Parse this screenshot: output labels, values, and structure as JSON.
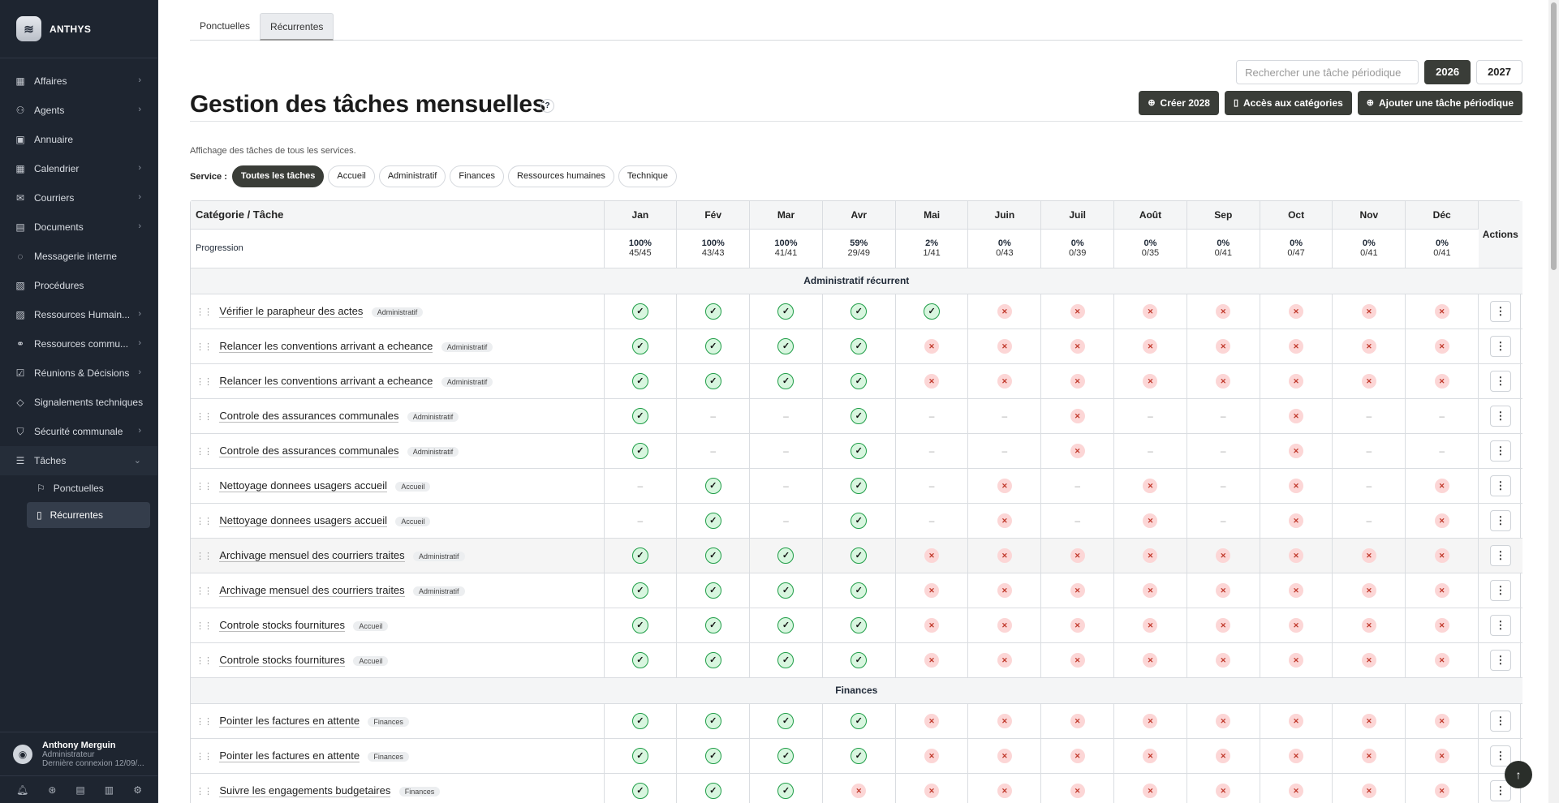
{
  "brand": {
    "name": "ANTHYS"
  },
  "sidebar": {
    "items": [
      {
        "label": "Affaires",
        "icon": "calculator-icon",
        "chevron": true
      },
      {
        "label": "Agents",
        "icon": "users-icon",
        "chevron": true
      },
      {
        "label": "Annuaire",
        "icon": "contact-card-icon",
        "chevron": false
      },
      {
        "label": "Calendrier",
        "icon": "calendar-icon",
        "chevron": true
      },
      {
        "label": "Courriers",
        "icon": "mailbox-icon",
        "chevron": true
      },
      {
        "label": "Documents",
        "icon": "document-icon",
        "chevron": true
      },
      {
        "label": "Messagerie interne",
        "icon": "chat-icon",
        "chevron": false
      },
      {
        "label": "Procédures",
        "icon": "procedure-icon",
        "chevron": false
      },
      {
        "label": "Ressources Humain...",
        "icon": "badge-icon",
        "chevron": true
      },
      {
        "label": "Ressources commu...",
        "icon": "shared-resources-icon",
        "chevron": true
      },
      {
        "label": "Réunions & Décisions",
        "icon": "calendar-check-icon",
        "chevron": true
      },
      {
        "label": "Signalements techniques",
        "icon": "warning-diamond-icon",
        "chevron": false
      },
      {
        "label": "Sécurité communale",
        "icon": "shield-icon",
        "chevron": true
      },
      {
        "label": "Tâches",
        "icon": "list-icon",
        "chevron": true
      }
    ],
    "sub_items": [
      {
        "label": "Ponctuelles",
        "icon": "flag-icon"
      },
      {
        "label": "Récurrentes",
        "icon": "clipboard-icon"
      }
    ]
  },
  "user": {
    "name": "Anthony Merguin",
    "role": "Administrateur",
    "last_login": "Dernière connexion 12/09/..."
  },
  "tabs": [
    {
      "label": "Ponctuelles"
    },
    {
      "label": "Récurrentes"
    }
  ],
  "search": {
    "placeholder": "Rechercher une tâche périodique"
  },
  "years": [
    "2026",
    "2027"
  ],
  "page": {
    "title": "Gestion des tâches mensuelles",
    "help": "?",
    "description": "Affichage des tâches de tous les services.",
    "service_label": "Service :"
  },
  "buttons": {
    "create": "Créer 2028",
    "categories": "Accès aux catégories",
    "add_task": "Ajouter une tâche périodique"
  },
  "filters": [
    "Toutes les tâches",
    "Accueil",
    "Administratif",
    "Finances",
    "Ressources humaines",
    "Technique"
  ],
  "table": {
    "col_category": "Catégorie / Tâche",
    "col_actions": "Actions",
    "months": [
      "Jan",
      "Fév",
      "Mar",
      "Avr",
      "Mai",
      "Juin",
      "Juil",
      "Août",
      "Sep",
      "Oct",
      "Nov",
      "Déc"
    ],
    "progress_label": "Progression",
    "progress": [
      {
        "pct": "100%",
        "frac": "45/45"
      },
      {
        "pct": "100%",
        "frac": "43/43"
      },
      {
        "pct": "100%",
        "frac": "41/41"
      },
      {
        "pct": "59%",
        "frac": "29/49"
      },
      {
        "pct": "2%",
        "frac": "1/41"
      },
      {
        "pct": "0%",
        "frac": "0/43"
      },
      {
        "pct": "0%",
        "frac": "0/39"
      },
      {
        "pct": "0%",
        "frac": "0/35"
      },
      {
        "pct": "0%",
        "frac": "0/41"
      },
      {
        "pct": "0%",
        "frac": "0/47"
      },
      {
        "pct": "0%",
        "frac": "0/41"
      },
      {
        "pct": "0%",
        "frac": "0/41"
      }
    ],
    "sections": [
      {
        "title": "Administratif récurrent",
        "rows": [
          {
            "name": "Vérifier le parapheur des actes",
            "badge": "Administratif",
            "status": [
              "ok",
              "ok",
              "ok",
              "ok",
              "ok",
              "ko",
              "ko",
              "ko",
              "ko",
              "ko",
              "ko",
              "ko"
            ]
          },
          {
            "name": "Relancer les conventions arrivant a echeance",
            "badge": "Administratif",
            "status": [
              "ok",
              "ok",
              "ok",
              "ok",
              "ko",
              "ko",
              "ko",
              "ko",
              "ko",
              "ko",
              "ko",
              "ko"
            ]
          },
          {
            "name": "Relancer les conventions arrivant a echeance",
            "badge": "Administratif",
            "status": [
              "ok",
              "ok",
              "ok",
              "ok",
              "ko",
              "ko",
              "ko",
              "ko",
              "ko",
              "ko",
              "ko",
              "ko"
            ]
          },
          {
            "name": "Controle des assurances communales",
            "badge": "Administratif",
            "status": [
              "ok",
              "na",
              "na",
              "ok",
              "na",
              "na",
              "ko",
              "na",
              "na",
              "ko",
              "na",
              "na"
            ]
          },
          {
            "name": "Controle des assurances communales",
            "badge": "Administratif",
            "status": [
              "ok",
              "na",
              "na",
              "ok",
              "na",
              "na",
              "ko",
              "na",
              "na",
              "ko",
              "na",
              "na"
            ]
          },
          {
            "name": "Nettoyage donnees usagers accueil",
            "badge": "Accueil",
            "status": [
              "na",
              "ok",
              "na",
              "ok",
              "na",
              "ko",
              "na",
              "ko",
              "na",
              "ko",
              "na",
              "ko"
            ]
          },
          {
            "name": "Nettoyage donnees usagers accueil",
            "badge": "Accueil",
            "status": [
              "na",
              "ok",
              "na",
              "ok",
              "na",
              "ko",
              "na",
              "ko",
              "na",
              "ko",
              "na",
              "ko"
            ]
          },
          {
            "name": "Archivage mensuel des courriers traites",
            "badge": "Administratif",
            "status": [
              "ok",
              "ok",
              "ok",
              "ok",
              "ko",
              "ko",
              "ko",
              "ko",
              "ko",
              "ko",
              "ko",
              "ko"
            ],
            "highlight": true
          },
          {
            "name": "Archivage mensuel des courriers traites",
            "badge": "Administratif",
            "status": [
              "ok",
              "ok",
              "ok",
              "ok",
              "ko",
              "ko",
              "ko",
              "ko",
              "ko",
              "ko",
              "ko",
              "ko"
            ]
          },
          {
            "name": "Controle stocks fournitures",
            "badge": "Accueil",
            "status": [
              "ok",
              "ok",
              "ok",
              "ok",
              "ko",
              "ko",
              "ko",
              "ko",
              "ko",
              "ko",
              "ko",
              "ko"
            ]
          },
          {
            "name": "Controle stocks fournitures",
            "badge": "Accueil",
            "status": [
              "ok",
              "ok",
              "ok",
              "ok",
              "ko",
              "ko",
              "ko",
              "ko",
              "ko",
              "ko",
              "ko",
              "ko"
            ]
          }
        ]
      },
      {
        "title": "Finances",
        "rows": [
          {
            "name": "Pointer les factures en attente",
            "badge": "Finances",
            "status": [
              "ok",
              "ok",
              "ok",
              "ok",
              "ko",
              "ko",
              "ko",
              "ko",
              "ko",
              "ko",
              "ko",
              "ko"
            ]
          },
          {
            "name": "Pointer les factures en attente",
            "badge": "Finances",
            "status": [
              "ok",
              "ok",
              "ok",
              "ok",
              "ko",
              "ko",
              "ko",
              "ko",
              "ko",
              "ko",
              "ko",
              "ko"
            ]
          },
          {
            "name": "Suivre les engagements budgetaires",
            "badge": "Finances",
            "status": [
              "ok",
              "ok",
              "ok",
              "ko",
              "ko",
              "ko",
              "ko",
              "ko",
              "ko",
              "ko",
              "ko",
              "ko"
            ]
          }
        ]
      }
    ]
  }
}
